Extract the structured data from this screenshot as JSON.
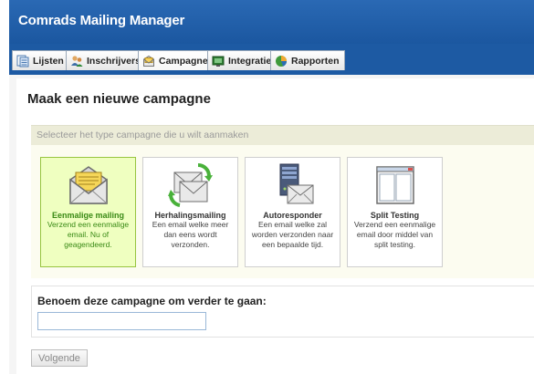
{
  "app": {
    "title": "Comrads Mailing Manager"
  },
  "tabs": [
    {
      "label": "Lijsten",
      "icon": "lists-icon"
    },
    {
      "label": "Inschrijvers",
      "icon": "subscribers-icon"
    },
    {
      "label": "Campagnes",
      "icon": "campaigns-icon",
      "active": true
    },
    {
      "label": "Integratie",
      "icon": "integration-icon"
    },
    {
      "label": "Rapporten",
      "icon": "reports-icon"
    }
  ],
  "page": {
    "title": "Maak een nieuwe campagne"
  },
  "campaign_type": {
    "header": "Selecteer het type campagne die u wilt aanmaken",
    "options": [
      {
        "title": "Eenmalige mailing",
        "description": "Verzend een eenmalige email. Nu of geagendeerd.",
        "icon": "envelope-icon",
        "selected": true
      },
      {
        "title": "Herhalingsmailing",
        "description": "Een email welke meer dan eens wordt verzonden.",
        "icon": "recurring-mail-icon"
      },
      {
        "title": "Autoresponder",
        "description": "Een email welke zal worden verzonden naar een bepaalde tijd.",
        "icon": "autoresponder-icon"
      },
      {
        "title": "Split Testing",
        "description": "Verzend een eenmalige email door middel van split testing.",
        "icon": "split-window-icon"
      }
    ]
  },
  "campaign_name": {
    "label": "Benoem deze campagne om verder te gaan:",
    "value": ""
  },
  "actions": {
    "next_label": "Volgende"
  },
  "colors": {
    "header_blue": "#1d5aa3",
    "selected_card_bg": "#efffc0",
    "selected_text": "#3a8a15",
    "section_header_bg": "#ececd8"
  }
}
